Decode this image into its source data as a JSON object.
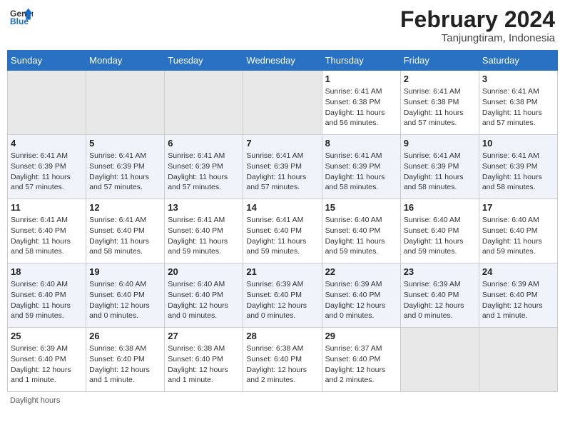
{
  "header": {
    "logo_line1": "General",
    "logo_line2": "Blue",
    "month_year": "February 2024",
    "location": "Tanjungtiram, Indonesia"
  },
  "days_of_week": [
    "Sunday",
    "Monday",
    "Tuesday",
    "Wednesday",
    "Thursday",
    "Friday",
    "Saturday"
  ],
  "footer": {
    "daylight_label": "Daylight hours"
  },
  "weeks": [
    [
      {
        "day": "",
        "sunrise": "",
        "sunset": "",
        "daylight": "",
        "empty": true
      },
      {
        "day": "",
        "sunrise": "",
        "sunset": "",
        "daylight": "",
        "empty": true
      },
      {
        "day": "",
        "sunrise": "",
        "sunset": "",
        "daylight": "",
        "empty": true
      },
      {
        "day": "",
        "sunrise": "",
        "sunset": "",
        "daylight": "",
        "empty": true
      },
      {
        "day": "1",
        "sunrise": "Sunrise: 6:41 AM",
        "sunset": "Sunset: 6:38 PM",
        "daylight": "Daylight: 11 hours and 56 minutes.",
        "empty": false
      },
      {
        "day": "2",
        "sunrise": "Sunrise: 6:41 AM",
        "sunset": "Sunset: 6:38 PM",
        "daylight": "Daylight: 11 hours and 57 minutes.",
        "empty": false
      },
      {
        "day": "3",
        "sunrise": "Sunrise: 6:41 AM",
        "sunset": "Sunset: 6:38 PM",
        "daylight": "Daylight: 11 hours and 57 minutes.",
        "empty": false
      }
    ],
    [
      {
        "day": "4",
        "sunrise": "Sunrise: 6:41 AM",
        "sunset": "Sunset: 6:39 PM",
        "daylight": "Daylight: 11 hours and 57 minutes.",
        "empty": false
      },
      {
        "day": "5",
        "sunrise": "Sunrise: 6:41 AM",
        "sunset": "Sunset: 6:39 PM",
        "daylight": "Daylight: 11 hours and 57 minutes.",
        "empty": false
      },
      {
        "day": "6",
        "sunrise": "Sunrise: 6:41 AM",
        "sunset": "Sunset: 6:39 PM",
        "daylight": "Daylight: 11 hours and 57 minutes.",
        "empty": false
      },
      {
        "day": "7",
        "sunrise": "Sunrise: 6:41 AM",
        "sunset": "Sunset: 6:39 PM",
        "daylight": "Daylight: 11 hours and 57 minutes.",
        "empty": false
      },
      {
        "day": "8",
        "sunrise": "Sunrise: 6:41 AM",
        "sunset": "Sunset: 6:39 PM",
        "daylight": "Daylight: 11 hours and 58 minutes.",
        "empty": false
      },
      {
        "day": "9",
        "sunrise": "Sunrise: 6:41 AM",
        "sunset": "Sunset: 6:39 PM",
        "daylight": "Daylight: 11 hours and 58 minutes.",
        "empty": false
      },
      {
        "day": "10",
        "sunrise": "Sunrise: 6:41 AM",
        "sunset": "Sunset: 6:39 PM",
        "daylight": "Daylight: 11 hours and 58 minutes.",
        "empty": false
      }
    ],
    [
      {
        "day": "11",
        "sunrise": "Sunrise: 6:41 AM",
        "sunset": "Sunset: 6:40 PM",
        "daylight": "Daylight: 11 hours and 58 minutes.",
        "empty": false
      },
      {
        "day": "12",
        "sunrise": "Sunrise: 6:41 AM",
        "sunset": "Sunset: 6:40 PM",
        "daylight": "Daylight: 11 hours and 58 minutes.",
        "empty": false
      },
      {
        "day": "13",
        "sunrise": "Sunrise: 6:41 AM",
        "sunset": "Sunset: 6:40 PM",
        "daylight": "Daylight: 11 hours and 59 minutes.",
        "empty": false
      },
      {
        "day": "14",
        "sunrise": "Sunrise: 6:41 AM",
        "sunset": "Sunset: 6:40 PM",
        "daylight": "Daylight: 11 hours and 59 minutes.",
        "empty": false
      },
      {
        "day": "15",
        "sunrise": "Sunrise: 6:40 AM",
        "sunset": "Sunset: 6:40 PM",
        "daylight": "Daylight: 11 hours and 59 minutes.",
        "empty": false
      },
      {
        "day": "16",
        "sunrise": "Sunrise: 6:40 AM",
        "sunset": "Sunset: 6:40 PM",
        "daylight": "Daylight: 11 hours and 59 minutes.",
        "empty": false
      },
      {
        "day": "17",
        "sunrise": "Sunrise: 6:40 AM",
        "sunset": "Sunset: 6:40 PM",
        "daylight": "Daylight: 11 hours and 59 minutes.",
        "empty": false
      }
    ],
    [
      {
        "day": "18",
        "sunrise": "Sunrise: 6:40 AM",
        "sunset": "Sunset: 6:40 PM",
        "daylight": "Daylight: 11 hours and 59 minutes.",
        "empty": false
      },
      {
        "day": "19",
        "sunrise": "Sunrise: 6:40 AM",
        "sunset": "Sunset: 6:40 PM",
        "daylight": "Daylight: 12 hours and 0 minutes.",
        "empty": false
      },
      {
        "day": "20",
        "sunrise": "Sunrise: 6:40 AM",
        "sunset": "Sunset: 6:40 PM",
        "daylight": "Daylight: 12 hours and 0 minutes.",
        "empty": false
      },
      {
        "day": "21",
        "sunrise": "Sunrise: 6:39 AM",
        "sunset": "Sunset: 6:40 PM",
        "daylight": "Daylight: 12 hours and 0 minutes.",
        "empty": false
      },
      {
        "day": "22",
        "sunrise": "Sunrise: 6:39 AM",
        "sunset": "Sunset: 6:40 PM",
        "daylight": "Daylight: 12 hours and 0 minutes.",
        "empty": false
      },
      {
        "day": "23",
        "sunrise": "Sunrise: 6:39 AM",
        "sunset": "Sunset: 6:40 PM",
        "daylight": "Daylight: 12 hours and 0 minutes.",
        "empty": false
      },
      {
        "day": "24",
        "sunrise": "Sunrise: 6:39 AM",
        "sunset": "Sunset: 6:40 PM",
        "daylight": "Daylight: 12 hours and 1 minute.",
        "empty": false
      }
    ],
    [
      {
        "day": "25",
        "sunrise": "Sunrise: 6:39 AM",
        "sunset": "Sunset: 6:40 PM",
        "daylight": "Daylight: 12 hours and 1 minute.",
        "empty": false
      },
      {
        "day": "26",
        "sunrise": "Sunrise: 6:38 AM",
        "sunset": "Sunset: 6:40 PM",
        "daylight": "Daylight: 12 hours and 1 minute.",
        "empty": false
      },
      {
        "day": "27",
        "sunrise": "Sunrise: 6:38 AM",
        "sunset": "Sunset: 6:40 PM",
        "daylight": "Daylight: 12 hours and 1 minute.",
        "empty": false
      },
      {
        "day": "28",
        "sunrise": "Sunrise: 6:38 AM",
        "sunset": "Sunset: 6:40 PM",
        "daylight": "Daylight: 12 hours and 2 minutes.",
        "empty": false
      },
      {
        "day": "29",
        "sunrise": "Sunrise: 6:37 AM",
        "sunset": "Sunset: 6:40 PM",
        "daylight": "Daylight: 12 hours and 2 minutes.",
        "empty": false
      },
      {
        "day": "",
        "sunrise": "",
        "sunset": "",
        "daylight": "",
        "empty": true
      },
      {
        "day": "",
        "sunrise": "",
        "sunset": "",
        "daylight": "",
        "empty": true
      }
    ]
  ]
}
